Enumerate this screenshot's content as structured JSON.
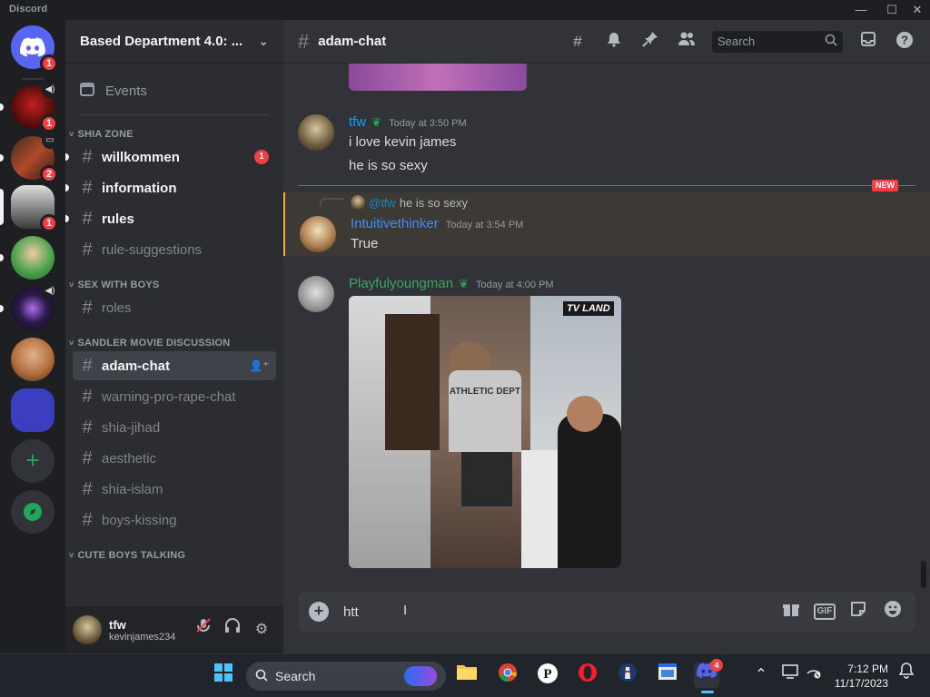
{
  "window": {
    "app_title": "Discord",
    "minimize": "—",
    "maximize": "☐",
    "close": "✕"
  },
  "guilds": {
    "home_badge": "1",
    "items": [
      {
        "badge": "1"
      },
      {
        "badge": "2"
      },
      {
        "badge": "1"
      },
      {
        "badge": ""
      },
      {
        "badge": ""
      },
      {
        "badge": ""
      },
      {
        "badge": ""
      }
    ],
    "add_label": "+",
    "explore_label": "⦿"
  },
  "server": {
    "name": "Based Department 4.0: ...",
    "events_label": "Events",
    "categories": [
      {
        "name": "SHIA ZONE",
        "channels": [
          {
            "name": "willkommen",
            "unread": true,
            "badge": "1"
          },
          {
            "name": "information",
            "unread": true,
            "badge": ""
          },
          {
            "name": "rules",
            "unread": true,
            "badge": ""
          },
          {
            "name": "rule-suggestions",
            "unread": false,
            "badge": ""
          }
        ]
      },
      {
        "name": "SEX WITH BOYS",
        "channels": [
          {
            "name": "roles",
            "unread": false,
            "badge": ""
          }
        ]
      },
      {
        "name": "SANDLER MOVIE DISCUSSION",
        "channels": [
          {
            "name": "adam-chat",
            "selected": true
          },
          {
            "name": "warning-pro-rape-chat"
          },
          {
            "name": "shia-jihad"
          },
          {
            "name": "aesthetic"
          },
          {
            "name": "shia-islam"
          },
          {
            "name": "boys-kissing"
          }
        ]
      },
      {
        "name": "CUTE BOYS TALKING",
        "channels": []
      }
    ]
  },
  "user": {
    "display_name": "tfw",
    "username": "kevinjames234"
  },
  "channel": {
    "name": "adam-chat",
    "search_placeholder": "Search"
  },
  "messages": [
    {
      "author": "tfw",
      "author_color": "#00a8fc",
      "time": "Today at 3:50 PM",
      "lines": [
        "i love kevin james",
        "he is so sexy"
      ]
    },
    {
      "reply_to": "@tfw",
      "reply_text": "he is so sexy",
      "author": "Intuitivethinker",
      "author_color": "#3e8ef7",
      "time": "Today at 3:54 PM",
      "lines": [
        "True"
      ]
    },
    {
      "author": "Playfulyoungman",
      "author_color": "#3ba55c",
      "time": "Today at 4:00 PM",
      "gif_tv": "TV LAND",
      "gif_shirt": "ATHLETIC DEPT"
    }
  ],
  "new_marker": "NEW",
  "composer": {
    "value": "htt"
  },
  "taskbar": {
    "search_label": "Search",
    "discord_badge": "4",
    "time": "7:12 PM",
    "date": "11/17/2023"
  }
}
